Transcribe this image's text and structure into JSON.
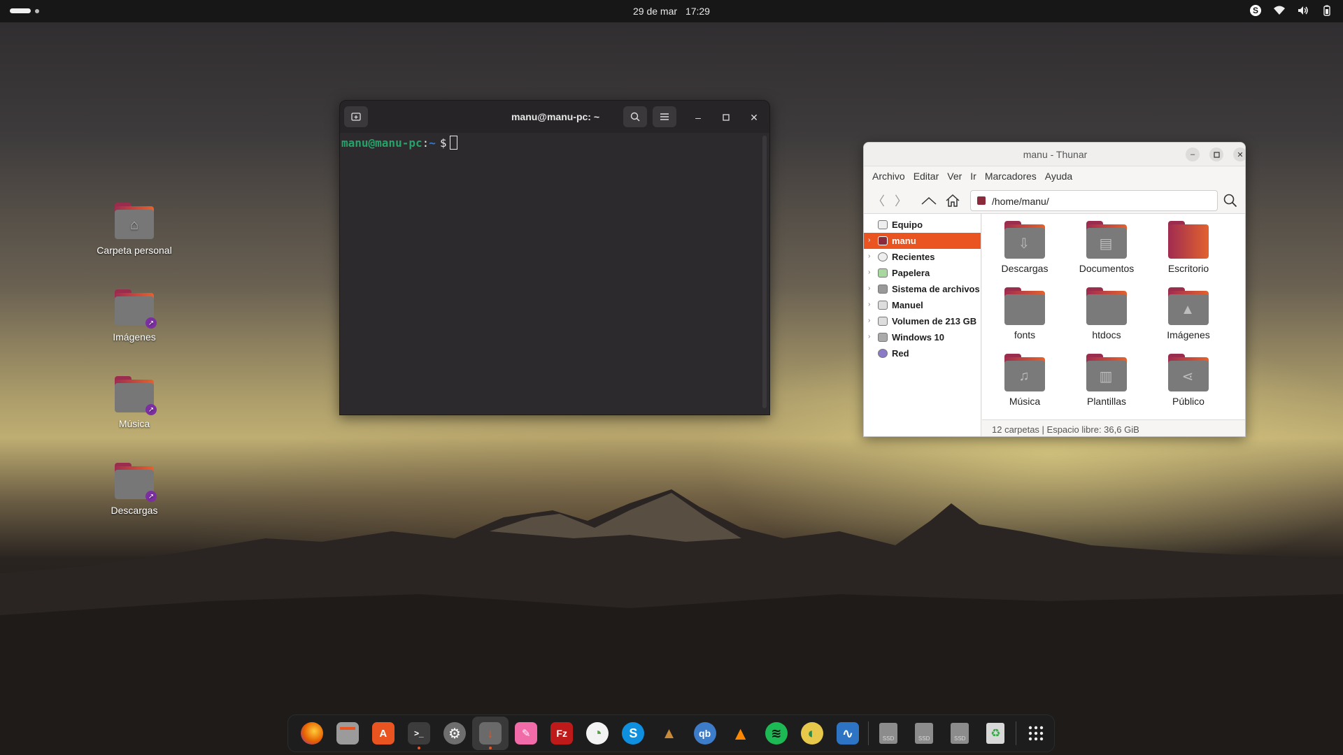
{
  "topbar": {
    "date": "29 de mar",
    "time": "17:29"
  },
  "desktop": {
    "icons": [
      {
        "label": "Carpeta personal",
        "icon": "home-folder-icon"
      },
      {
        "label": "Imágenes",
        "icon": "folder-link-icon"
      },
      {
        "label": "Música",
        "icon": "folder-link-icon"
      },
      {
        "label": "Descargas",
        "icon": "folder-link-icon"
      }
    ]
  },
  "terminal": {
    "title": "manu@manu-pc: ~",
    "prompt_user": "manu@manu-pc",
    "prompt_sep": ":",
    "prompt_path": "~",
    "prompt_symbol": "$"
  },
  "thunar": {
    "title": "manu - Thunar",
    "menu": [
      "Archivo",
      "Editar",
      "Ver",
      "Ir",
      "Marcadores",
      "Ayuda"
    ],
    "path": "/home/manu/",
    "sidebar": [
      {
        "label": "Equipo",
        "expander": false,
        "active": false
      },
      {
        "label": "manu",
        "expander": true,
        "active": true
      },
      {
        "label": "Recientes",
        "expander": true,
        "active": false
      },
      {
        "label": "Papelera",
        "expander": true,
        "active": false
      },
      {
        "label": "Sistema de archivos",
        "expander": true,
        "active": false
      },
      {
        "label": "Manuel",
        "expander": true,
        "active": false
      },
      {
        "label": "Volumen de 213 GB",
        "expander": true,
        "active": false
      },
      {
        "label": "Windows 10",
        "expander": true,
        "active": false
      },
      {
        "label": "Red",
        "expander": false,
        "active": false
      }
    ],
    "files": [
      {
        "label": "Descargas",
        "icon": "download-icon"
      },
      {
        "label": "Documentos",
        "icon": "document-icon"
      },
      {
        "label": "Escritorio",
        "icon": "desktop-icon"
      },
      {
        "label": "fonts",
        "icon": "folder-icon"
      },
      {
        "label": "htdocs",
        "icon": "folder-icon"
      },
      {
        "label": "Imágenes",
        "icon": "image-icon"
      },
      {
        "label": "Música",
        "icon": "music-icon"
      },
      {
        "label": "Plantillas",
        "icon": "template-icon"
      },
      {
        "label": "Público",
        "icon": "share-icon"
      }
    ],
    "status": "12 carpetas | Espacio libre: 36,6 GiB"
  },
  "dock": {
    "apps": [
      {
        "name": "firefox-icon",
        "glyph": "",
        "color": "#e66000",
        "running": false
      },
      {
        "name": "files-icon",
        "glyph": "",
        "color": "#9b9b9b",
        "running": false
      },
      {
        "name": "app-center-icon",
        "glyph": "A",
        "color": "#e95420",
        "running": false
      },
      {
        "name": "terminal-icon",
        "glyph": ">_",
        "color": "#3c3c3c",
        "running": true
      },
      {
        "name": "settings-icon",
        "glyph": "⚙",
        "color": "#6e6e6e",
        "running": false
      },
      {
        "name": "installer-icon",
        "glyph": "↓",
        "color": "#6a6a6a",
        "running": true
      },
      {
        "name": "paint-icon",
        "glyph": "✎",
        "color": "#f06ba8",
        "running": false
      },
      {
        "name": "filezilla-icon",
        "glyph": "Fz",
        "color": "#bf1a1a",
        "running": false
      },
      {
        "name": "disk-usage-icon",
        "glyph": "◔",
        "color": "#5a9a4a",
        "running": false
      },
      {
        "name": "skype-icon",
        "glyph": "S",
        "color": "#0f8fe0",
        "running": false
      },
      {
        "name": "vlc-alt-icon",
        "glyph": "▲",
        "color": "#8a5a2a",
        "running": false
      },
      {
        "name": "qbittorrent-icon",
        "glyph": "qb",
        "color": "#3d7cc9",
        "running": false
      },
      {
        "name": "vlc-icon",
        "glyph": "▲",
        "color": "#ff8800",
        "running": false
      },
      {
        "name": "spotify-icon",
        "glyph": "≋",
        "color": "#1db954",
        "running": false
      },
      {
        "name": "world-icon",
        "glyph": "◐",
        "color": "#2a8a4a",
        "running": false
      },
      {
        "name": "system-monitor-icon",
        "glyph": "∿",
        "color": "#2d74c4",
        "running": false
      }
    ],
    "drives": [
      {
        "name": "ssd-drive-icon",
        "label": "SSD"
      },
      {
        "name": "ssd-drive-icon",
        "label": "SSD"
      },
      {
        "name": "ssd-drive-icon",
        "label": "SSD"
      }
    ],
    "trash": {
      "name": "trash-icon",
      "glyph": "♻"
    },
    "apps_grid": {
      "name": "show-apps-icon"
    }
  },
  "colors": {
    "accent": "#e95420",
    "prompt_green": "#26a269",
    "prompt_blue": "#2a7bde"
  }
}
